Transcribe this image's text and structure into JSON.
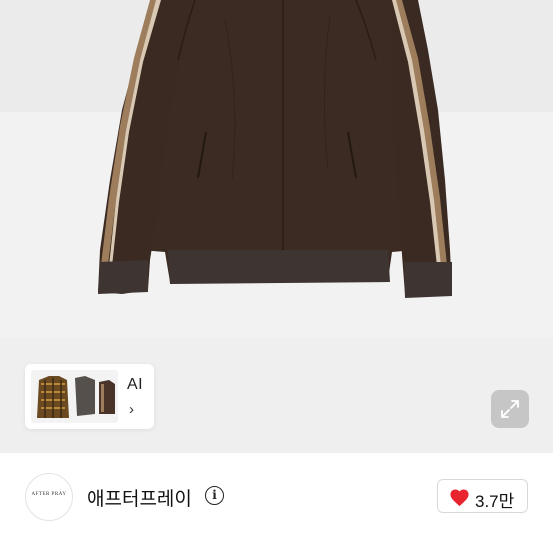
{
  "product": {
    "image_alt": "brown track jacket with tan side stripes",
    "colors": {
      "jacket": "#3b2a22",
      "stripe": "#9d7d5c",
      "background": "#f1f1f2"
    }
  },
  "thumbnail": {
    "label": "AI",
    "chevron": "›",
    "icon": "chevron-right-icon"
  },
  "expand": {
    "icon": "expand-icon"
  },
  "seller": {
    "avatar_text": "AFTER PRAY",
    "name": "애프터프레이",
    "info_icon_glyph": "i"
  },
  "like": {
    "icon": "heart-icon",
    "count": "3.7만",
    "heart_color": "#e8242f"
  }
}
